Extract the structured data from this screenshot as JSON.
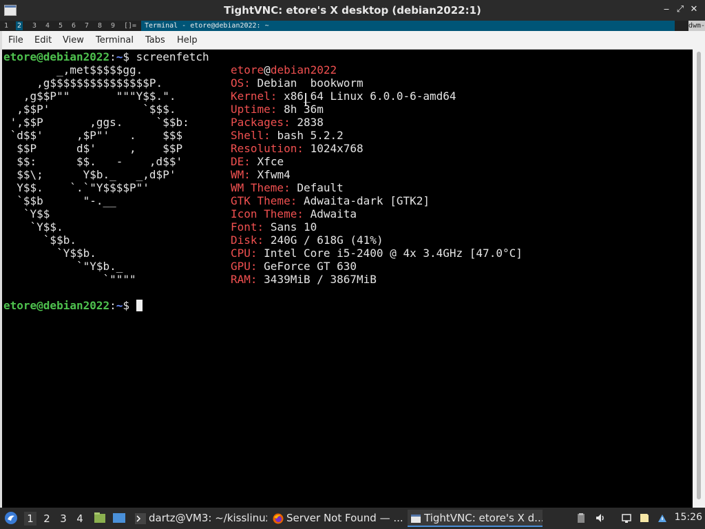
{
  "vnc": {
    "title": "TightVNC: etore's X desktop (debian2022:1)",
    "min": "‒",
    "max": "⤢",
    "close": "✕"
  },
  "dwm": {
    "tags": [
      "1",
      "2",
      "3",
      "4",
      "5",
      "6",
      "7",
      "8",
      "9"
    ],
    "layout": "[]=",
    "window_title": "Terminal - etore@debian2022: ~",
    "status": "dwm-"
  },
  "terminal": {
    "menu": [
      "File",
      "Edit",
      "View",
      "Terminal",
      "Tabs",
      "Help"
    ],
    "prompt_user": "etore@debian2022",
    "prompt_sep": ":",
    "prompt_path": "~",
    "prompt_dollar": "$ ",
    "command": "screenfetch",
    "logo": [
      "        _,met$$$$$gg.",
      "     ,g$$$$$$$$$$$$$$$P.",
      "   ,g$$P\"\"       \"\"\"Y$$.\".",
      "  ,$$P'              `$$$.",
      " ',$$P       ,ggs.     `$$b:",
      " `d$$'     ,$P\"'   .    $$$",
      "  $$P      d$'     ,    $$P",
      "  $$:      $$.   -    ,d$$'",
      "  $$\\;      Y$b._   _,d$P'",
      "  Y$$.    `.`\"Y$$$$P\"'",
      "  `$$b      \"-.__",
      "   `Y$$",
      "    `Y$$.",
      "      `$$b.",
      "        `Y$$b.",
      "           `\"Y$b._",
      "               `\"\"\"\""
    ],
    "info_user": "etore",
    "info_at": "@",
    "info_host": "debian2022",
    "info": [
      {
        "label": "OS:",
        "value": "Debian  bookworm"
      },
      {
        "label": "Kernel:",
        "value": "x86_64 Linux 6.0.0-6-amd64"
      },
      {
        "label": "Uptime:",
        "value": "8h 36m"
      },
      {
        "label": "Packages:",
        "value": "2838"
      },
      {
        "label": "Shell:",
        "value": "bash 5.2.2"
      },
      {
        "label": "Resolution:",
        "value": "1024x768"
      },
      {
        "label": "DE:",
        "value": "Xfce"
      },
      {
        "label": "WM:",
        "value": "Xfwm4"
      },
      {
        "label": "WM Theme:",
        "value": "Default"
      },
      {
        "label": "GTK Theme:",
        "value": "Adwaita-dark [GTK2]"
      },
      {
        "label": "Icon Theme:",
        "value": "Adwaita"
      },
      {
        "label": "Font:",
        "value": "Sans 10"
      },
      {
        "label": "Disk:",
        "value": "240G / 618G (41%)"
      },
      {
        "label": "CPU:",
        "value": "Intel Core i5-2400 @ 4x 3.4GHz [47.0°C]"
      },
      {
        "label": "GPU:",
        "value": "GeForce GT 630"
      },
      {
        "label": "RAM:",
        "value": "3439MiB / 3867MiB"
      }
    ]
  },
  "panel": {
    "workspaces": [
      "1",
      "2",
      "3",
      "4"
    ],
    "tasks": [
      {
        "label": "dartz@VM3: ~/kisslinux",
        "icon": "terminal-icon"
      },
      {
        "label": "Server Not Found — ...",
        "icon": "firefox-icon"
      },
      {
        "label": "TightVNC: etore's X d...",
        "icon": "vnc-window-icon"
      }
    ],
    "clock": "15:26"
  }
}
